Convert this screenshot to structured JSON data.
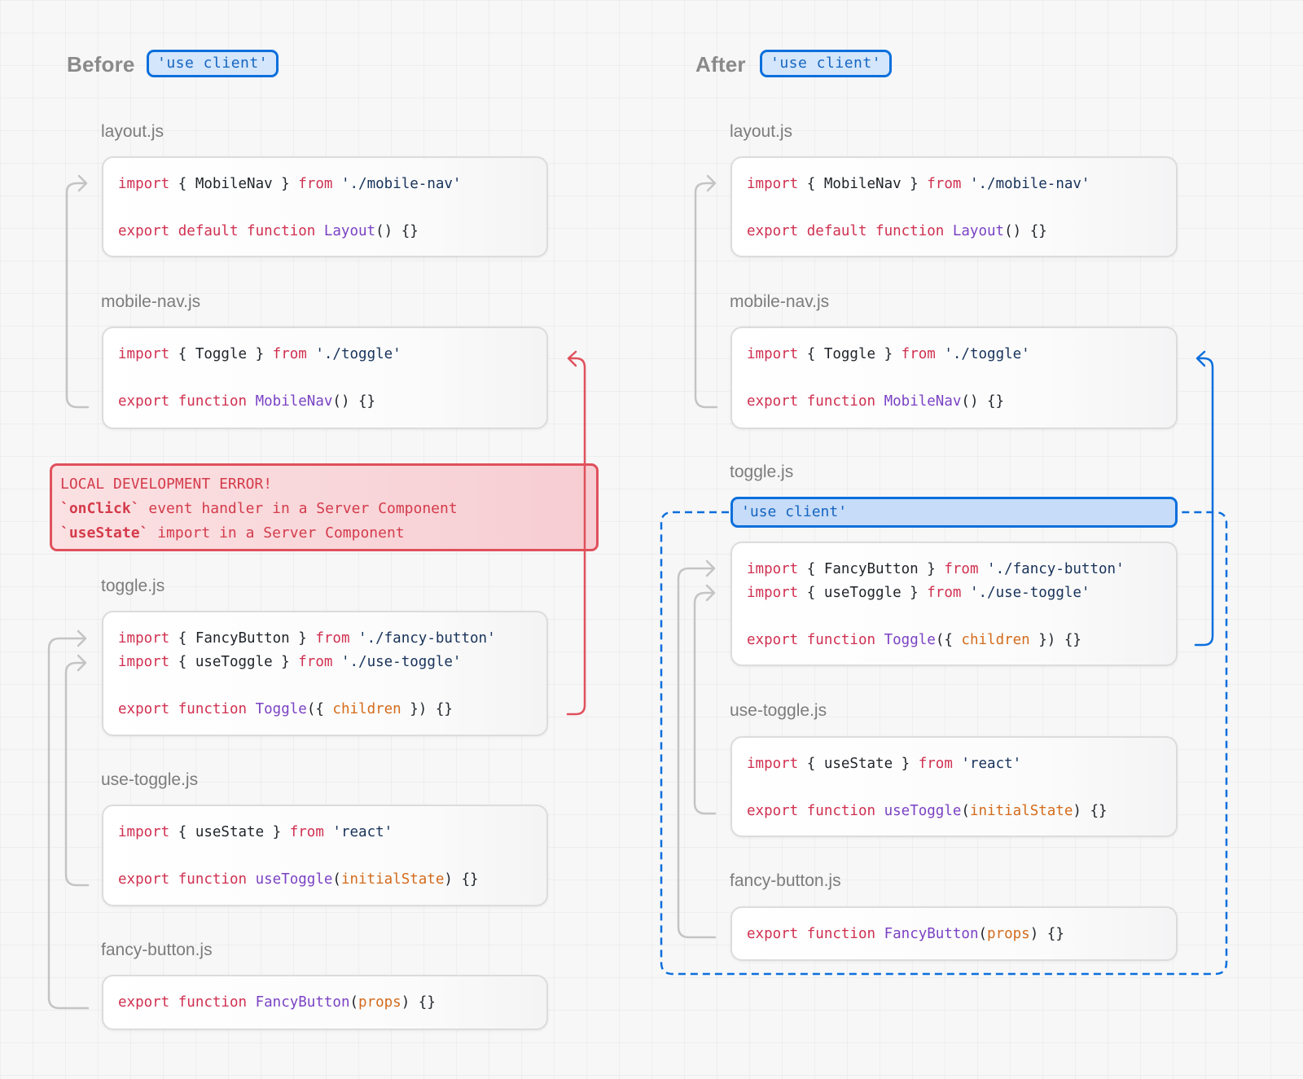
{
  "before": {
    "heading": "Before",
    "badge": "'use client'",
    "files": [
      {
        "name": "layout.js",
        "lines": [
          [
            [
              "kw",
              "import"
            ],
            [
              "id",
              " { MobileNav } "
            ],
            [
              "kw",
              "from"
            ],
            [
              "str",
              " './mobile-nav'"
            ]
          ],
          [],
          [
            [
              "kw",
              "export default function"
            ],
            [
              "fn",
              " Layout"
            ],
            [
              "id",
              "() {}"
            ]
          ]
        ]
      },
      {
        "name": "mobile-nav.js",
        "lines": [
          [
            [
              "kw",
              "import"
            ],
            [
              "id",
              " { Toggle } "
            ],
            [
              "kw",
              "from"
            ],
            [
              "str",
              " './toggle'"
            ]
          ],
          [],
          [
            [
              "kw",
              "export function"
            ],
            [
              "fn",
              " MobileNav"
            ],
            [
              "id",
              "() {}"
            ]
          ]
        ]
      },
      {
        "name": "toggle.js",
        "lines": [
          [
            [
              "kw",
              "import"
            ],
            [
              "id",
              " { FancyButton } "
            ],
            [
              "kw",
              "from"
            ],
            [
              "str",
              " './fancy-button'"
            ]
          ],
          [
            [
              "kw",
              "import"
            ],
            [
              "id",
              " { useToggle } "
            ],
            [
              "kw",
              "from"
            ],
            [
              "str",
              " './use-toggle'"
            ]
          ],
          [],
          [
            [
              "kw",
              "export function"
            ],
            [
              "fn",
              " Toggle"
            ],
            [
              "id",
              "({ "
            ],
            [
              "param",
              "children"
            ],
            [
              "id",
              " }) {}"
            ]
          ]
        ]
      },
      {
        "name": "use-toggle.js",
        "lines": [
          [
            [
              "kw",
              "import"
            ],
            [
              "id",
              " { useState } "
            ],
            [
              "kw",
              "from"
            ],
            [
              "str",
              " 'react'"
            ]
          ],
          [],
          [
            [
              "kw",
              "export function"
            ],
            [
              "fn",
              " useToggle"
            ],
            [
              "id",
              "("
            ],
            [
              "param",
              "initialState"
            ],
            [
              "id",
              ") {}"
            ]
          ]
        ]
      },
      {
        "name": "fancy-button.js",
        "lines": [
          [
            [
              "kw",
              "export function"
            ],
            [
              "fn",
              " FancyButton"
            ],
            [
              "id",
              "("
            ],
            [
              "param",
              "props"
            ],
            [
              "id",
              ") {}"
            ]
          ]
        ]
      }
    ],
    "error": {
      "title": "LOCAL DEVELOPMENT ERROR!",
      "lines": [
        {
          "code": "`onClick`",
          "text": " event handler in a Server Component"
        },
        {
          "code": "`useState`",
          "text": " import in a Server Component"
        }
      ]
    }
  },
  "after": {
    "heading": "After",
    "badge": "'use client'",
    "client_boundary_label": "'use client'",
    "files": [
      {
        "name": "layout.js",
        "lines": [
          [
            [
              "kw",
              "import"
            ],
            [
              "id",
              " { MobileNav } "
            ],
            [
              "kw",
              "from"
            ],
            [
              "str",
              " './mobile-nav'"
            ]
          ],
          [],
          [
            [
              "kw",
              "export default function"
            ],
            [
              "fn",
              " Layout"
            ],
            [
              "id",
              "() {}"
            ]
          ]
        ]
      },
      {
        "name": "mobile-nav.js",
        "lines": [
          [
            [
              "kw",
              "import"
            ],
            [
              "id",
              " { Toggle } "
            ],
            [
              "kw",
              "from"
            ],
            [
              "str",
              " './toggle'"
            ]
          ],
          [],
          [
            [
              "kw",
              "export function"
            ],
            [
              "fn",
              " MobileNav"
            ],
            [
              "id",
              "() {}"
            ]
          ]
        ]
      },
      {
        "name": "toggle.js",
        "lines": [
          [
            [
              "kw",
              "import"
            ],
            [
              "id",
              " { FancyButton } "
            ],
            [
              "kw",
              "from"
            ],
            [
              "str",
              " './fancy-button'"
            ]
          ],
          [
            [
              "kw",
              "import"
            ],
            [
              "id",
              " { useToggle } "
            ],
            [
              "kw",
              "from"
            ],
            [
              "str",
              " './use-toggle'"
            ]
          ],
          [],
          [
            [
              "kw",
              "export function"
            ],
            [
              "fn",
              " Toggle"
            ],
            [
              "id",
              "({ "
            ],
            [
              "param",
              "children"
            ],
            [
              "id",
              " }) {}"
            ]
          ]
        ]
      },
      {
        "name": "use-toggle.js",
        "lines": [
          [
            [
              "kw",
              "import"
            ],
            [
              "id",
              " { useState } "
            ],
            [
              "kw",
              "from"
            ],
            [
              "str",
              " 'react'"
            ]
          ],
          [],
          [
            [
              "kw",
              "export function"
            ],
            [
              "fn",
              " useToggle"
            ],
            [
              "id",
              "("
            ],
            [
              "param",
              "initialState"
            ],
            [
              "id",
              ") {}"
            ]
          ]
        ]
      },
      {
        "name": "fancy-button.js",
        "lines": [
          [
            [
              "kw",
              "export function"
            ],
            [
              "fn",
              " FancyButton"
            ],
            [
              "id",
              "("
            ],
            [
              "param",
              "props"
            ],
            [
              "id",
              ") {}"
            ]
          ]
        ]
      }
    ]
  },
  "colors": {
    "keyword": "#d03050",
    "function": "#7a42c4",
    "string": "#17325a",
    "param": "#d46b1c",
    "error": "#e0505c",
    "client": "#0b6fdc",
    "connector": "#c4c4c4"
  }
}
